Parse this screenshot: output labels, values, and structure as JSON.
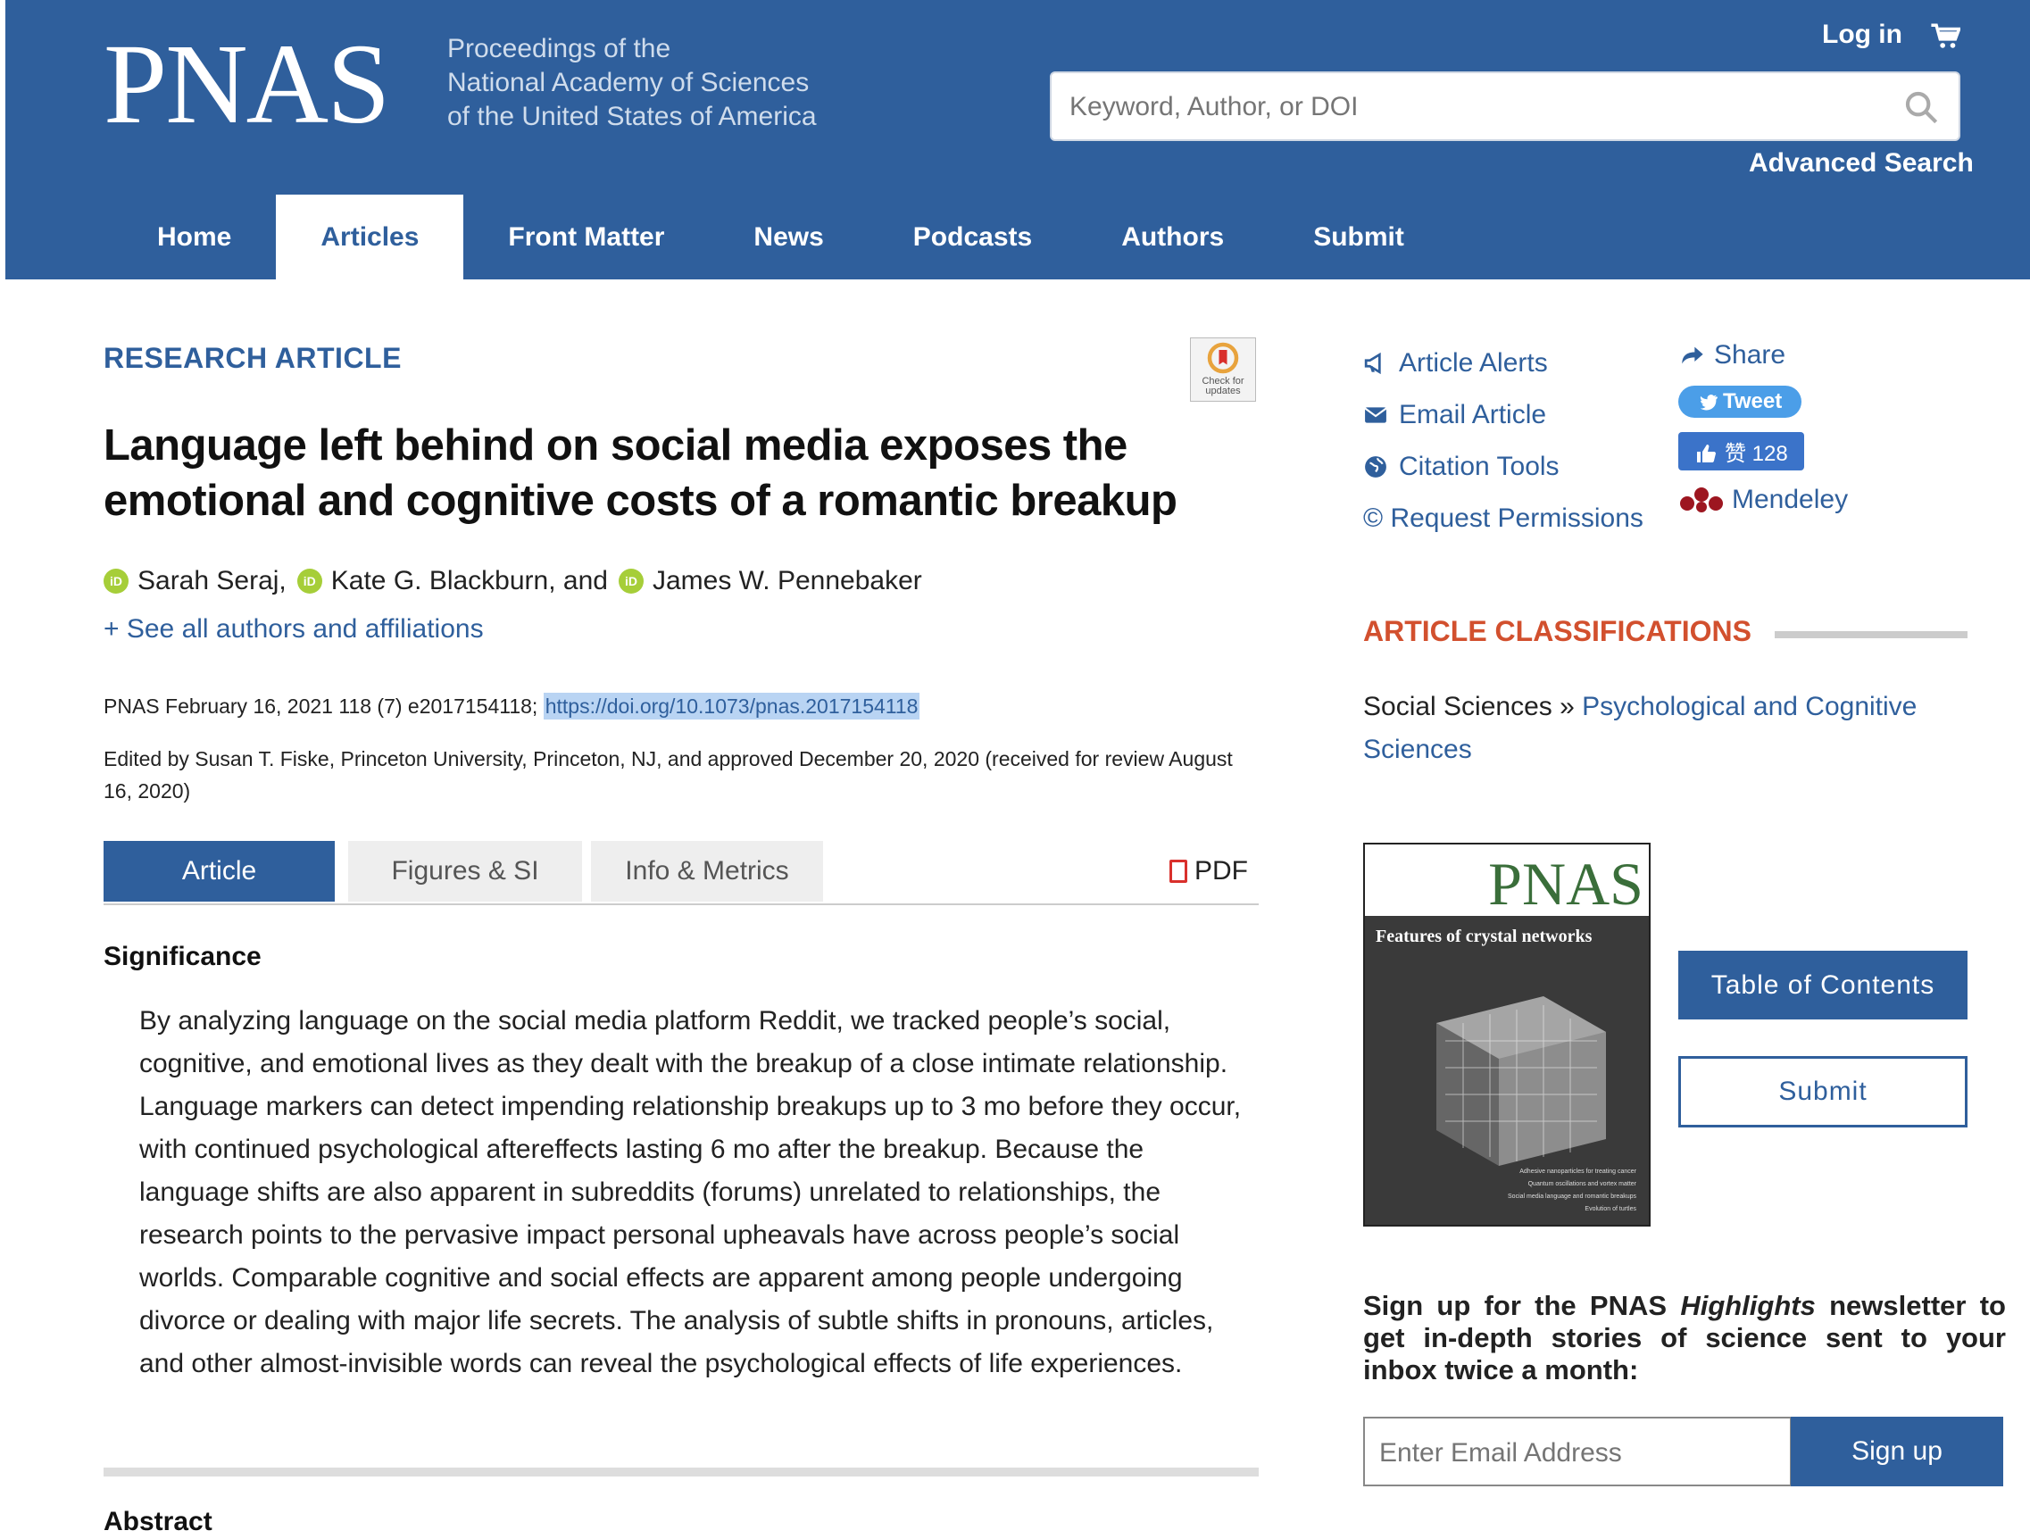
{
  "header": {
    "logo": "PNAS",
    "tagline": [
      "Proceedings of the",
      "National Academy of Sciences",
      "of the United States of America"
    ],
    "login": "Log in",
    "search_placeholder": "Keyword, Author, or DOI",
    "advanced_search": "Advanced Search",
    "brand_color": "#2f5f9c"
  },
  "nav": [
    "Home",
    "Articles",
    "Front Matter",
    "News",
    "Podcasts",
    "Authors",
    "Submit"
  ],
  "nav_active": "Articles",
  "article": {
    "type_label": "RESEARCH ARTICLE",
    "check_updates": "Check for updates",
    "title": "Language left behind on social media exposes the emotional and cognitive costs of a romantic breakup",
    "authors": [
      {
        "name": "Sarah Seraj,",
        "orcid": "iD"
      },
      {
        "name": "Kate G. Blackburn, and",
        "orcid": "iD"
      },
      {
        "name": "James W. Pennebaker",
        "orcid": "iD"
      }
    ],
    "see_all": "+ See all authors and affiliations",
    "citation_text": "PNAS February 16, 2021 118 (7) e2017154118; ",
    "doi": "https://doi.org/10.1073/pnas.2017154118",
    "edited": "Edited by Susan T. Fiske, Princeton University, Princeton, NJ, and approved December 20, 2020 (received for review August 16, 2020)",
    "tabs": [
      "Article",
      "Figures & SI",
      "Info & Metrics"
    ],
    "pdf": "PDF",
    "significance_heading": "Significance",
    "significance_text": "By analyzing language on the social media platform Reddit, we tracked people’s social, cognitive, and emotional lives as they dealt with the breakup of a close intimate relationship. Language markers can detect impending relationship breakups up to 3 mo before they occur, with continued psychological aftereffects lasting 6 mo after the breakup. Because the language shifts are also apparent in subreddits (forums) unrelated to relationships, the research points to the pervasive impact personal upheavals have across people’s social worlds. Comparable cognitive and social effects are apparent among people undergoing divorce or dealing with major life secrets. The analysis of subtle shifts in pronouns, articles, and other almost-invisible words can reveal the psychological effects of life experiences.",
    "abstract_heading": "Abstract"
  },
  "sidebar": {
    "tools": [
      {
        "label": "Article Alerts",
        "icon": "megaphone-icon"
      },
      {
        "label": "Email Article",
        "icon": "envelope-icon"
      },
      {
        "label": "Citation Tools",
        "icon": "globe-icon"
      },
      {
        "label": "© Request Permissions",
        "icon": "copyright-icon"
      }
    ],
    "share": "Share",
    "tweet": "Tweet",
    "like": "赞 128",
    "mendeley": "Mendeley",
    "classifications_heading": "ARTICLE CLASSIFICATIONS",
    "classification_parent": "Social Sciences",
    "classification_sep": " » ",
    "classification_link": "Psychological and Cognitive Sciences",
    "cover_logo": "PNAS",
    "cover_title": "Features of crystal networks",
    "cover_lines": [
      "Adhesive nanoparticles for treating cancer",
      "Quantum oscillations and vortex matter",
      "Social media language and romantic breakups",
      "Evolution of turtles"
    ],
    "toc_button": "Table of Contents",
    "submit_button": "Submit",
    "newsletter_before": "Sign up for the PNAS ",
    "newsletter_em": "Highlights",
    "newsletter_after": " newsletter to get in-depth stories of science sent to your inbox twice a month:",
    "email_placeholder": "Enter Email Address",
    "signup": "Sign up",
    "accent_color": "#d2502e"
  }
}
